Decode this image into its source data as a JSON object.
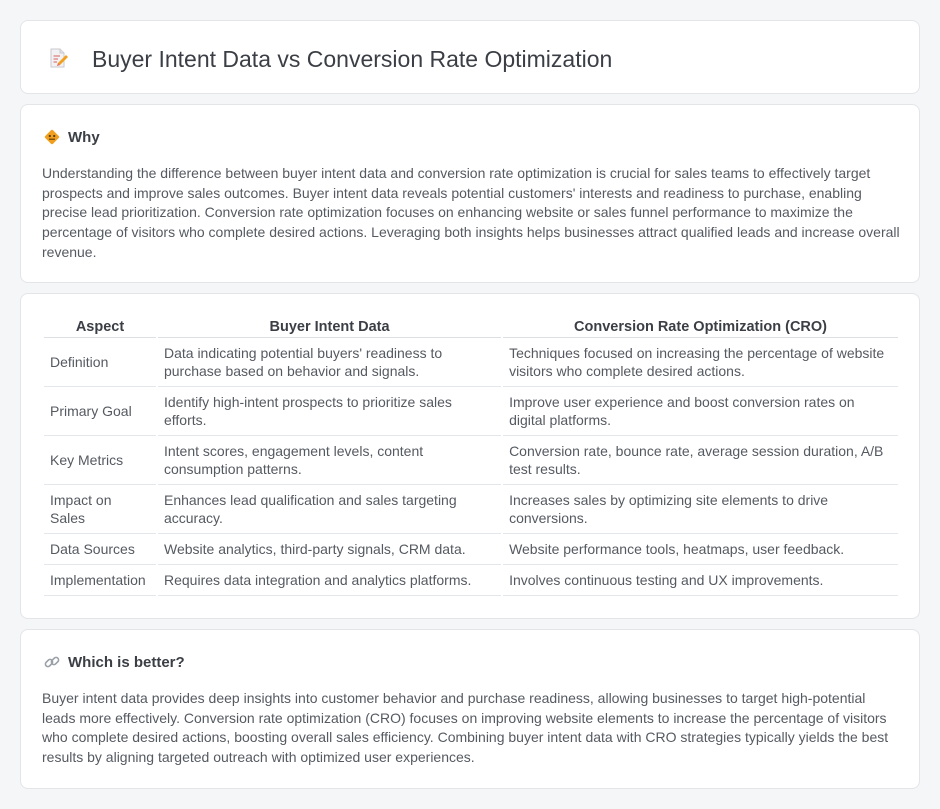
{
  "header": {
    "title": "Buyer Intent Data vs Conversion Rate Optimization"
  },
  "why": {
    "title": "Why",
    "body": "Understanding the difference between buyer intent data and conversion rate optimization is crucial for sales teams to effectively target prospects and improve sales outcomes. Buyer intent data reveals potential customers' interests and readiness to purchase, enabling precise lead prioritization. Conversion rate optimization focuses on enhancing website or sales funnel performance to maximize the percentage of visitors who complete desired actions. Leveraging both insights helps businesses attract qualified leads and increase overall revenue."
  },
  "table": {
    "headers": [
      "Aspect",
      "Buyer Intent Data",
      "Conversion Rate Optimization (CRO)"
    ],
    "rows": [
      [
        "Definition",
        "Data indicating potential buyers' readiness to purchase based on behavior and signals.",
        "Techniques focused on increasing the percentage of website visitors who complete desired actions."
      ],
      [
        "Primary Goal",
        "Identify high-intent prospects to prioritize sales efforts.",
        "Improve user experience and boost conversion rates on digital platforms."
      ],
      [
        "Key Metrics",
        "Intent scores, engagement levels, content consumption patterns.",
        "Conversion rate, bounce rate, average session duration, A/B test results."
      ],
      [
        "Impact on Sales",
        "Enhances lead qualification and sales targeting accuracy.",
        "Increases sales by optimizing site elements to drive conversions."
      ],
      [
        "Data Sources",
        "Website analytics, third-party signals, CRM data.",
        "Website performance tools, heatmaps, user feedback."
      ],
      [
        "Implementation",
        "Requires data integration and analytics platforms.",
        "Involves continuous testing and UX improvements."
      ]
    ]
  },
  "better": {
    "title": "Which is better?",
    "body": "Buyer intent data provides deep insights into customer behavior and purchase readiness, allowing businesses to target high-potential leads more effectively. Conversion rate optimization (CRO) focuses on improving website elements to increase the percentage of visitors who complete desired actions, boosting overall sales efficiency. Combining buyer intent data with CRO strategies typically yields the best results by aligning targeted outreach with optimized user experiences."
  },
  "icons": {
    "title": "document-pencil-icon",
    "why": "diamond-sign-icon",
    "better": "link-icon"
  },
  "colors": {
    "background": "#f5f6f8",
    "card": "#ffffff",
    "icon_orange": "#f0a01e",
    "icon_pink": "#e88b8b"
  }
}
